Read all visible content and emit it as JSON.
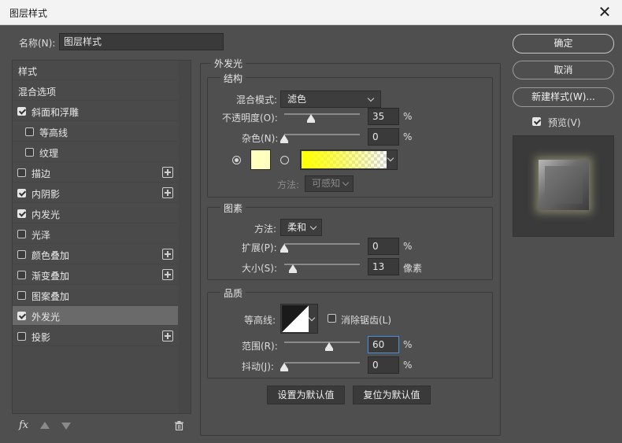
{
  "window": {
    "title": "图层样式",
    "close_glyph": "✕"
  },
  "name_field": {
    "label": "名称(N):",
    "value": "图层样式"
  },
  "buttons": {
    "ok": "确定",
    "cancel": "取消",
    "new_style": "新建样式(W)...",
    "preview": "预览(V)"
  },
  "sidebar": {
    "items": [
      {
        "label": "样式"
      },
      {
        "label": "混合选项"
      },
      {
        "label": "斜面和浮雕"
      },
      {
        "label": "等高线"
      },
      {
        "label": "纹理"
      },
      {
        "label": "描边"
      },
      {
        "label": "内阴影"
      },
      {
        "label": "内发光"
      },
      {
        "label": "光泽"
      },
      {
        "label": "颜色叠加"
      },
      {
        "label": "渐变叠加"
      },
      {
        "label": "图案叠加"
      },
      {
        "label": "外发光"
      },
      {
        "label": "投影"
      }
    ],
    "footer": {
      "fx": "fx"
    }
  },
  "panel": {
    "title": "外发光",
    "structure": {
      "title": "结构",
      "blend_mode_label": "混合模式:",
      "blend_mode_value": "滤色",
      "opacity_label": "不透明度(O):",
      "opacity_value": "35",
      "opacity_unit": "%",
      "noise_label": "杂色(N):",
      "noise_value": "0",
      "noise_unit": "%",
      "swatch_color": "#ffffbe",
      "method_label": "方法:",
      "method_value": "可感知"
    },
    "elements": {
      "title": "图素",
      "technique_label": "方法:",
      "technique_value": "柔和",
      "spread_label": "扩展(P):",
      "spread_value": "0",
      "spread_unit": "%",
      "size_label": "大小(S):",
      "size_value": "13",
      "size_unit": "像素"
    },
    "quality": {
      "title": "品质",
      "contour_label": "等高线:",
      "antialias_label": "消除锯齿(L)",
      "range_label": "范围(R):",
      "range_value": "60",
      "range_unit": "%",
      "jitter_label": "抖动(J):",
      "jitter_value": "0",
      "jitter_unit": "%"
    },
    "set_default": "设置为默认值",
    "reset_default": "复位为默认值"
  }
}
